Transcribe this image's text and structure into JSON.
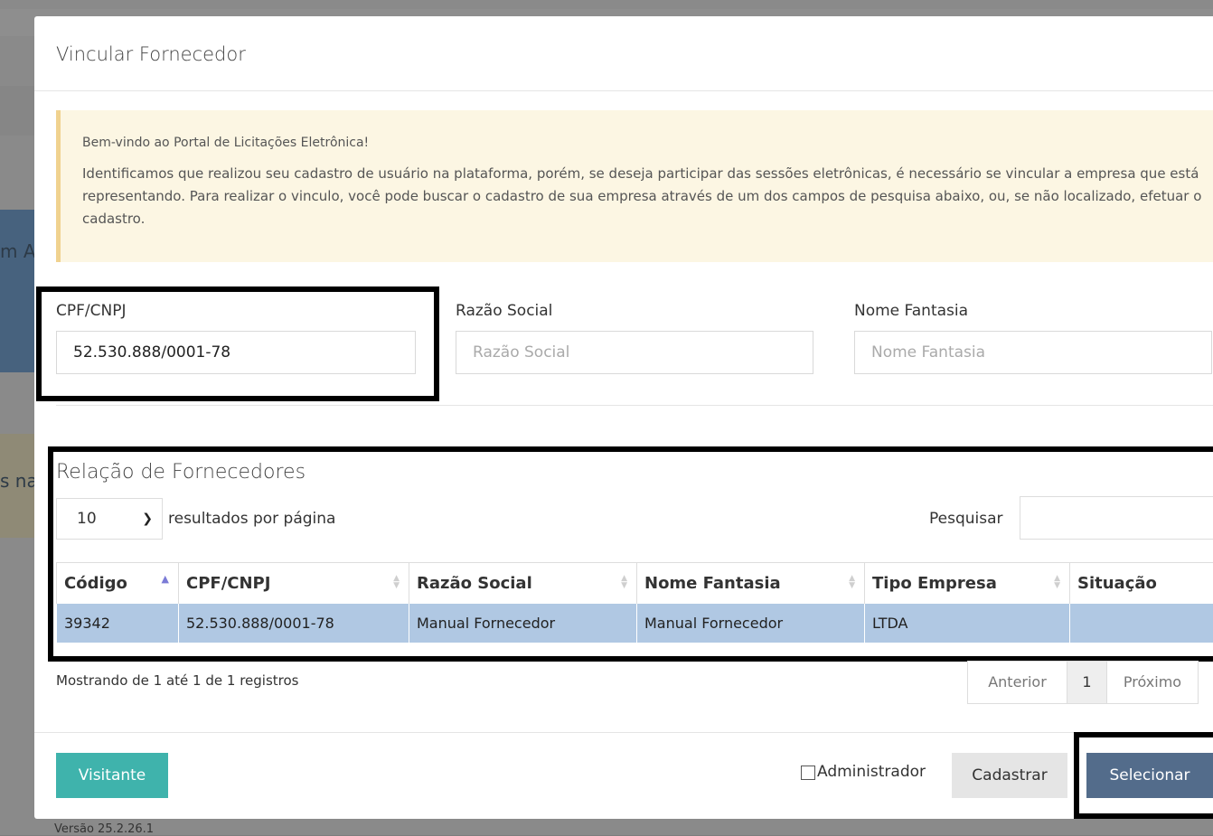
{
  "background": {
    "fragment_1": "m A",
    "fragment_2": "s na",
    "bottom_text": "Versão 25.2.26.1"
  },
  "modal": {
    "title": "Vincular Fornecedor",
    "alert": {
      "line1": "Bem-vindo ao Portal de Licitações Eletrônica!",
      "line2": "Identificamos que realizou seu cadastro de usuário na plataforma, porém, se deseja participar das sessões eletrônicas, é necessário se vincular a empresa que está representando. Para realizar o vinculo, você pode buscar o cadastro de sua empresa através de um dos campos de pesquisa abaixo, ou, se não localizado, efetuar o cadastro."
    },
    "fields": {
      "cpf_label": "CPF/CNPJ",
      "cpf_value": "52.530.888/0001-78",
      "razao_label": "Razão Social",
      "razao_placeholder": "Razão Social",
      "fantasia_label": "Nome Fantasia",
      "fantasia_placeholder": "Nome Fantasia"
    },
    "table": {
      "title": "Relação de Fornecedores",
      "page_size": "10",
      "page_size_text": "resultados por página",
      "search_label": "Pesquisar",
      "columns": [
        "Código",
        "CPF/CNPJ",
        "Razão Social",
        "Nome Fantasia",
        "Tipo Empresa",
        "Situação"
      ],
      "rows": [
        [
          "39342",
          "52.530.888/0001-78",
          "Manual Fornecedor",
          "Manual Fornecedor",
          "LTDA",
          ""
        ]
      ],
      "info": "Mostrando de 1 até 1 de 1 registros",
      "pager": {
        "prev": "Anterior",
        "current": "1",
        "next": "Próximo"
      }
    },
    "footer": {
      "visitor_label": "Visitante",
      "admin_label": "Administrador",
      "register_label": "Cadastrar",
      "select_label": "Selecionar"
    }
  },
  "colors": {
    "selected_row": "#b0c8e3",
    "visitor_button": "#3fb3ac",
    "select_button": "#536c8b",
    "alert_bg": "#fcf6e3"
  }
}
